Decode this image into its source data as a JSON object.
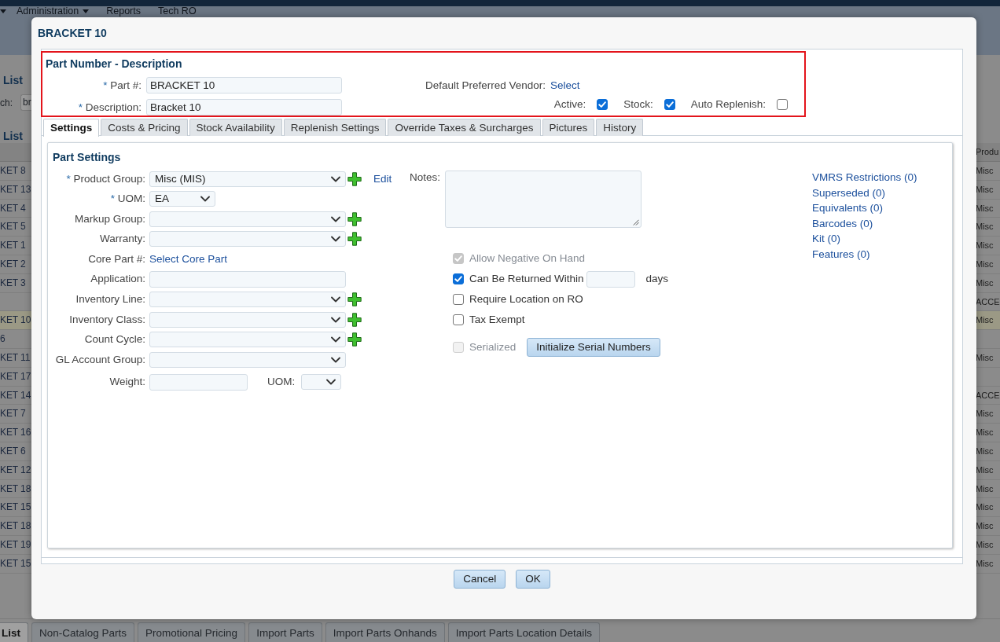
{
  "page": {
    "menu": [
      {
        "dropdown": true
      },
      {
        "label": "Administration",
        "dropdown": true
      },
      {
        "label": "Reports",
        "dropdown": false
      },
      {
        "label": "Tech RO",
        "dropdown": false
      }
    ],
    "left_panel": {
      "title": "List",
      "search_label": "ch:",
      "search_value": "br",
      "list_title": "List"
    },
    "table": {
      "header": "Produ",
      "rows": [
        {
          "column_1": "KET 8",
          "column_2": "Misc",
          "selected": false
        },
        {
          "column_1": "KET 13",
          "column_2": "Misc",
          "selected": false
        },
        {
          "column_1": "KET 4",
          "column_2": "Misc",
          "selected": false
        },
        {
          "column_1": "KET 5",
          "column_2": "Misc",
          "selected": false
        },
        {
          "column_1": "KET 1",
          "column_2": "Misc",
          "selected": false
        },
        {
          "column_1": "KET 2",
          "column_2": "Misc",
          "selected": false
        },
        {
          "column_1": "KET 3",
          "column_2": "Misc",
          "selected": false
        },
        {
          "column_2": "ACCE",
          "selected": false
        },
        {
          "column_1": "KET 10",
          "column_2": "Misc",
          "selected": true
        },
        {
          "column_1": "6",
          "selected": false
        },
        {
          "column_1": "KET 11",
          "column_2": "Misc",
          "selected": false
        },
        {
          "column_1": "KET 17",
          "selected": false
        },
        {
          "column_1": "KET 14",
          "column_2": "ACCE",
          "selected": false
        },
        {
          "column_1": "KET 7",
          "column_2": "Misc",
          "selected": false
        },
        {
          "column_1": "KET 16",
          "column_2": "Misc",
          "selected": false
        },
        {
          "column_1": "KET 6",
          "column_2": "Misc",
          "selected": false
        },
        {
          "column_1": "KET 12",
          "column_2": "Misc",
          "selected": false
        },
        {
          "column_1": "KET 18",
          "column_2": "Misc",
          "selected": false
        },
        {
          "column_1": "KET 15",
          "column_2": "Misc",
          "selected": false
        },
        {
          "column_1": "KET 18",
          "column_2": "Misc",
          "selected": false
        },
        {
          "column_1": "KET 19",
          "column_2": "Misc",
          "selected": false
        },
        {
          "column_1": "KET 15",
          "column_2": "Misc",
          "selected": false
        }
      ]
    },
    "bottom_tabs": [
      {
        "label": "List",
        "selected": true
      },
      {
        "label": "Non-Catalog Parts",
        "selected": false
      },
      {
        "label": "Promotional Pricing",
        "selected": false
      },
      {
        "label": "Import Parts",
        "selected": false
      },
      {
        "label": "Import Parts Onhands",
        "selected": false
      },
      {
        "label": "Import Parts Location Details",
        "selected": false
      }
    ]
  },
  "dialog": {
    "title": "BRACKET 10",
    "required_mark": "*",
    "header": {
      "title": "Part Number - Description",
      "fields": [
        {
          "label": "Part #:",
          "required": true,
          "value": "BRACKET 10"
        },
        {
          "label": "Description:",
          "required": true,
          "value": "Bracket 10"
        }
      ],
      "vendor": {
        "label": "Default Preferred Vendor:",
        "link": "Select"
      },
      "flags": [
        {
          "label": "Active:",
          "checked": true
        },
        {
          "label": "Stock:",
          "checked": true
        },
        {
          "label": "Auto Replenish:",
          "checked": false
        }
      ]
    },
    "tabs": [
      {
        "label": "Settings",
        "selected": true
      },
      {
        "label": "Costs & Pricing",
        "selected": false
      },
      {
        "label": "Stock Availability",
        "selected": false
      },
      {
        "label": "Replenish Settings",
        "selected": false
      },
      {
        "label": "Override Taxes & Surcharges",
        "selected": false
      },
      {
        "label": "Pictures",
        "selected": false
      },
      {
        "label": "History",
        "selected": false
      }
    ],
    "settings": {
      "title": "Part Settings",
      "fields": [
        {
          "kind": "select",
          "label": "Product Group:",
          "required": true,
          "value": "Misc (MIS)",
          "add": true,
          "link": "Edit"
        },
        {
          "kind": "unit",
          "label": "UOM:",
          "required": true,
          "value": "EA"
        },
        {
          "kind": "select",
          "label": "Markup Group:",
          "required": false,
          "add": true
        },
        {
          "kind": "select",
          "label": "Warranty:",
          "required": false,
          "add": true
        },
        {
          "kind": "link",
          "label": "Core Part #:",
          "required": false,
          "link": "Select Core Part"
        },
        {
          "kind": "text",
          "label": "Application:",
          "required": false
        },
        {
          "kind": "select",
          "label": "Inventory Line:",
          "required": false,
          "add": true
        },
        {
          "kind": "select",
          "label": "Inventory Class:",
          "required": false,
          "add": true
        },
        {
          "kind": "select",
          "label": "Count Cycle:",
          "required": false,
          "add": true
        },
        {
          "kind": "select",
          "label": "GL Account Group:",
          "required": false,
          "add": false
        },
        {
          "kind": "measure",
          "label": "Weight:",
          "required": false,
          "unit_label": "UOM:"
        }
      ],
      "notes": {
        "label": "Notes:"
      },
      "options": [
        {
          "kind": "check",
          "label": "Allow Negative On Hand",
          "checked": true,
          "disabled": true
        },
        {
          "kind": "days",
          "label": "Can Be Returned Within",
          "checked": true,
          "disabled": false,
          "unit": "days"
        },
        {
          "kind": "check",
          "label": "Require Location on RO",
          "checked": false,
          "disabled": false
        },
        {
          "kind": "check",
          "label": "Tax Exempt",
          "checked": false,
          "disabled": false
        },
        {
          "kind": "serial",
          "label": "Serialized",
          "checked": false,
          "disabled": true,
          "button": "Initialize Serial Numbers"
        }
      ],
      "links": [
        "VMRS Restrictions (0)",
        "Superseded (0)",
        "Equivalents (0)",
        "Barcodes (0)",
        "Kit (0)",
        "Features (0)"
      ]
    },
    "buttons": [
      "Cancel",
      "OK"
    ]
  }
}
